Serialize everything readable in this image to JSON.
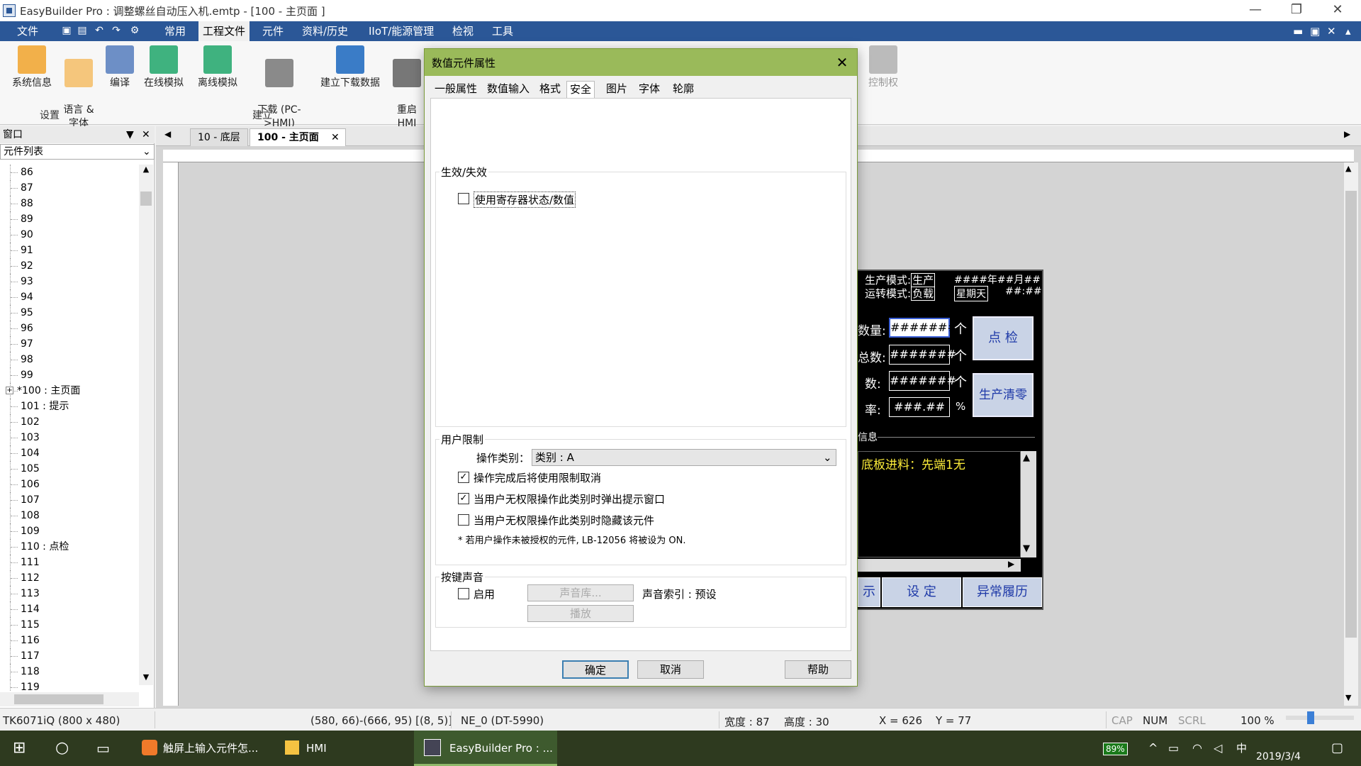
{
  "window": {
    "title": "EasyBuilder Pro : 调整螺丝自动压入机.emtp - [100 - 主页面 ]",
    "minimize": "—",
    "restore": "❐",
    "close": "✕"
  },
  "menubar": {
    "items": [
      "文件",
      "常用",
      "工程文件",
      "元件",
      "资料/历史",
      "IIoT/能源管理",
      "检视",
      "工具"
    ],
    "right_controls": [
      "▬",
      "▣",
      "✕",
      "▴"
    ]
  },
  "ribbon": {
    "buttons": [
      "系统信息",
      "语言 &\n字体",
      "编译",
      "在线模拟",
      "离线模拟",
      "下载 (PC-\n>HMI)",
      "建立下载数据",
      "重启\nHMI",
      "控制权"
    ],
    "groups": [
      "设置",
      "建立"
    ]
  },
  "left_panel": {
    "header": "窗口",
    "combo": "元件列表",
    "items": [
      "86",
      "87",
      "88",
      "89",
      "90",
      "91",
      "92",
      "93",
      "94",
      "95",
      "96",
      "97",
      "98",
      "99",
      "*100 : 主页面",
      "101 : 提示",
      "102",
      "103",
      "104",
      "105",
      "106",
      "107",
      "108",
      "109",
      "110 : 点检",
      "111",
      "112",
      "113",
      "114",
      "115",
      "116",
      "117",
      "118",
      "119"
    ]
  },
  "doc_tabs": [
    "10 - 底层",
    "100 - 主页面"
  ],
  "hmi": {
    "mode_prod": "生产模式:",
    "mode_prod_val": "生产",
    "mode_run": "运转模式:",
    "mode_run_val": "负载",
    "date": "####年##月##日",
    "weekday": "星期天",
    "time": "##:##",
    "row1_label": "数量:",
    "row2_label": "总数:",
    "row3_label": "数:",
    "row4_label": "率:",
    "num_value": "#######",
    "rate_value": "###.##",
    "unit_ge": "个",
    "unit_pct": "%",
    "btn_check": "点 检",
    "btn_clear": "生产清零",
    "info_label": "信息",
    "info_text": "底板进料：先端1无",
    "btn_show": "示",
    "btn_settings": "设 定",
    "btn_alarm": "异常履历"
  },
  "dialog": {
    "title": "数值元件属性",
    "tabs": [
      "一般属性",
      "数值输入",
      "格式",
      "安全",
      "图片",
      "字体",
      "轮廓"
    ],
    "active_tab": "安全",
    "enable_group": "生效/失效",
    "use_register": "使用寄存器状态/数值",
    "user_group": "用户限制",
    "op_category_label": "操作类别：",
    "op_category_value": "类别 : A",
    "cancel_after": "操作完成后将使用限制取消",
    "popup_on_no_perm": "当用户无权限操作此类别时弹出提示窗口",
    "hide_on_no_perm": "当用户无权限操作此类别时隐藏该元件",
    "note": "* 若用户操作未被授权的元件, LB-12056 将被设为 ON.",
    "sound_group": "按键声音",
    "enable": "启用",
    "sound_lib": "声音库...",
    "sound_index": "声音索引 : 预设",
    "play": "播放",
    "ok": "确定",
    "cancel": "取消",
    "help": "帮助"
  },
  "statusbar": {
    "model": "TK6071iQ (800 x 480)",
    "coords": "(580, 66)-(666, 95) [(8, 5)]",
    "element": "NE_0 (DT-5990)",
    "width": "宽度 : 87",
    "height": "高度 : 30",
    "x": "X = 626",
    "y": "Y = 77",
    "cap": "CAP",
    "num": "NUM",
    "scrl": "SCRL",
    "zoom": "100 %"
  },
  "taskbar": {
    "items": [
      "触屏上输入元件怎...",
      "HMI",
      "EasyBuilder Pro : ..."
    ],
    "battery": "89%",
    "ime": "中",
    "date": "2019/3/4"
  }
}
